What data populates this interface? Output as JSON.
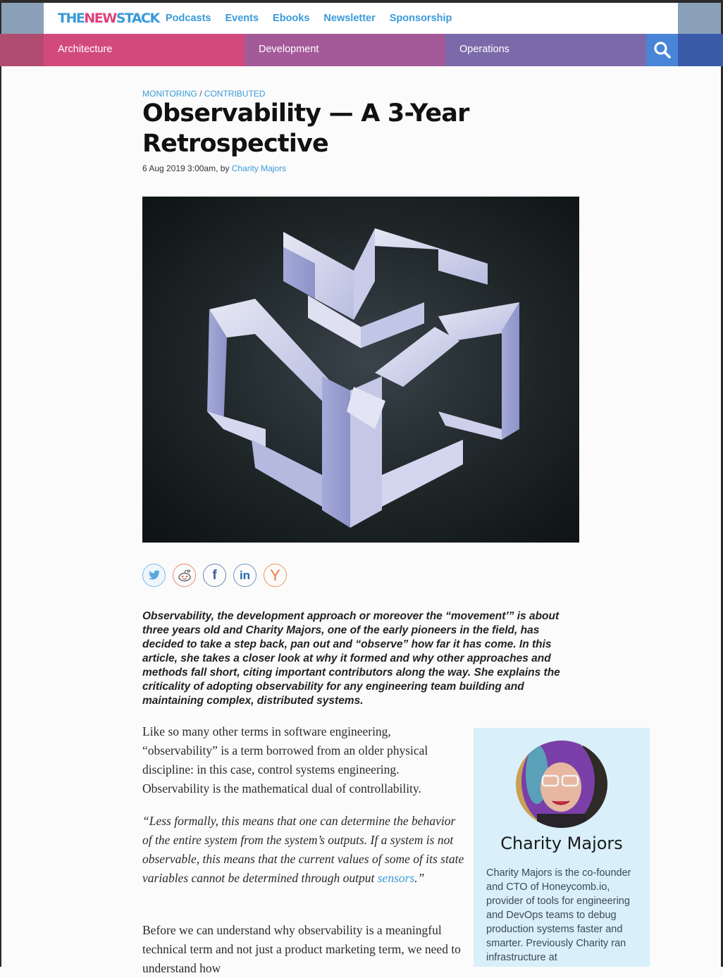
{
  "header": {
    "logo": {
      "part1": "THE",
      "part2": "NEW",
      "part3": "STACK"
    },
    "nav": [
      "Podcasts",
      "Events",
      "Ebooks",
      "Newsletter",
      "Sponsorship"
    ]
  },
  "categories": {
    "architecture": "Architecture",
    "development": "Development",
    "operations": "Operations"
  },
  "article": {
    "kicker": {
      "cat1": "MONITORING",
      "sep": " / ",
      "cat2": "CONTRIBUTED"
    },
    "title": "Observability — A 3-Year Retrospective",
    "byline": {
      "date": "6 Aug 2019 3:00am, by ",
      "author": "Charity Majors"
    },
    "share": [
      "twitter-icon",
      "reddit-icon",
      "facebook-icon",
      "linkedin-icon",
      "hackernews-icon"
    ],
    "intro": "Observability, the development approach or moreover the “movement’” is about three years old and Charity Majors, one of the early pioneers in the field, has decided to take a step back, pan out and “observe” how far it has come. In this article, she takes a closer look at why it formed and why other approaches and methods fall short, citing important contributors along the way. She explains the criticality of adopting observability for any engineering team building and maintaining complex, distributed systems.",
    "p1": "Like so many other terms in software engineering, “observability” is a term borrowed from an older physical discipline: in this case, control systems engineering. Observability is the mathematical dual of controllability.",
    "quote": {
      "text": "“Less formally, this means that one can determine the behavior of the entire system from the system’s outputs. If a system is not observable, this means that the current values of some of its state variables cannot be determined through output ",
      "link": "sensors",
      "end": ".”"
    },
    "p2": "Before we can understand why observability is a meaningful technical term and not just a product marketing term, we need to understand how"
  },
  "author_box": {
    "name": "Charity Majors",
    "bio": "Charity Majors is the co-founder and CTO of Honeycomb.io, provider of tools for engineering and DevOps teams to debug production systems faster and smarter. Previously Charity ran infrastructure at"
  },
  "colors": {
    "brand_blue": "#3a9ad9",
    "brand_pink": "#e0407a",
    "architecture": "#d24a7c",
    "development": "#a45a98",
    "operations": "#7b6aaa",
    "search": "#4a84d6",
    "bio_bg": "#d9effa"
  }
}
